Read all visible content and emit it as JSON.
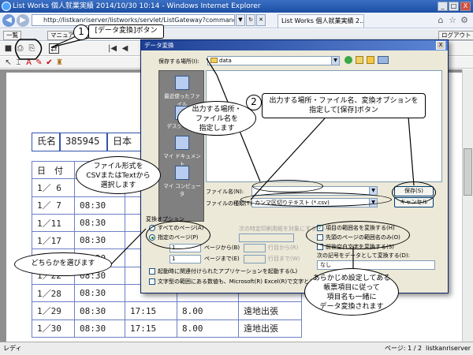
{
  "window": {
    "title": "List Works 個人就業実績 2014/10/30 10:14 - Windows Internet Explorer",
    "minimize_glyph": "_",
    "maximize_glyph": "□",
    "close_glyph": "X"
  },
  "browser": {
    "url": "http://listkanriserver/listworks/servlet/ListGateway?command=listbro",
    "tab_title": "List Works 個人就業実績 2...",
    "status_left": "レディ",
    "status_page": "ページ: 1 / 2",
    "status_server": "listkanriserver"
  },
  "app": {
    "btn_list": "一覧",
    "btn_manual": "マニュアル",
    "btn_logout": "ログアウト",
    "zoom_text": "倍",
    "page_first": "|◀",
    "page_prev": "◀"
  },
  "document": {
    "name_label": "氏名",
    "employee_id": "385945",
    "dept_partial": "日本",
    "header_day_label": "日　付",
    "rows": [
      {
        "date": "1／ 6",
        "start": "",
        "end": "",
        "hours": "",
        "note": ""
      },
      {
        "date": "1／ 7",
        "start": "08:30",
        "end": "",
        "hours": "",
        "note": ""
      },
      {
        "date": "1／11",
        "start": "08:30",
        "end": "",
        "hours": "",
        "note": ""
      },
      {
        "date": "1／17",
        "start": "08:30",
        "end": "",
        "hours": "",
        "note": ""
      },
      {
        "date": "1／18",
        "start": "08:30",
        "end": "",
        "hours": "",
        "note": ""
      },
      {
        "date": "1／22",
        "start": "08:30",
        "end": "",
        "hours": "",
        "note": ""
      },
      {
        "date": "1／28",
        "start": "08:30",
        "end": "",
        "hours": "",
        "note": ""
      },
      {
        "date": "1／29",
        "start": "08:30",
        "end": "17:15",
        "hours": "8.00",
        "note": "遠地出張"
      },
      {
        "date": "1／30",
        "start": "08:30",
        "end": "17:15",
        "hours": "8.00",
        "note": "遠地出張"
      }
    ]
  },
  "dialog": {
    "title": "データ変換",
    "close_glyph": "X",
    "save_in_label": "保存する場所(I):",
    "save_in_value": "data",
    "places": [
      "最近使ったファイル",
      "デスクトップ",
      "マイ ドキュメント",
      "マイ コンピュータ"
    ],
    "filename_label": "ファイル名(N):",
    "filename_value": "",
    "filetype_label": "ファイルの種類(T):",
    "filetype_value": "カンマ区切りテキスト (*.csv)",
    "save_button": "保存(S)",
    "cancel_button": "キャンセル",
    "options_group": "変換オプション",
    "radio_all": "すべてのページ(A)",
    "radio_range": "指定のページ(P)",
    "page_from_value": "1",
    "page_from_label": "ページから(B)",
    "page_to_value": "1",
    "page_to_label": "ページまで(E)",
    "row_from_label": "行目から(R)",
    "row_to_label": "行目まで(W)",
    "range_select_label": "次の特定印刷用紙を対象にする(Y):",
    "check_header": "項目の範囲名を変換する(H)",
    "check_first_page": "先頭のページの範囲名のみ(O)",
    "check_trim": "前後空白文字を変換する(S)",
    "numbering_label": "次の記号をデータとして変換する(D):",
    "numbering_value": "なし",
    "check_launch": "起動時に関連付けられたアプリケーションを起動する(L)",
    "check_excel": "文字型の範囲にある数値も、Microsoft(R) Excel(R)で文字として扱う(X)"
  },
  "callouts": {
    "num1": "1",
    "callout1": "[データ変換]ボタン",
    "num2": "2",
    "callout2_line1": "出力する場所・ファイル名、変換オプションを",
    "callout2_line2": "指定して[保存]ボタン",
    "callout_location_line1": "出力する場所・",
    "callout_location_line2": "ファイル名を",
    "callout_location_line3": "指定します",
    "callout_format_line1": "ファイル形式を",
    "callout_format_line2": "CSVまたはTextから",
    "callout_format_line3": "選択します",
    "callout_choose": "どちらかを選びます",
    "callout_header_line1": "あらかじめ設定してある",
    "callout_header_line2": "帳票項目に従って",
    "callout_header_line3": "項目名も一緒に",
    "callout_header_line4": "データ変換されます"
  }
}
